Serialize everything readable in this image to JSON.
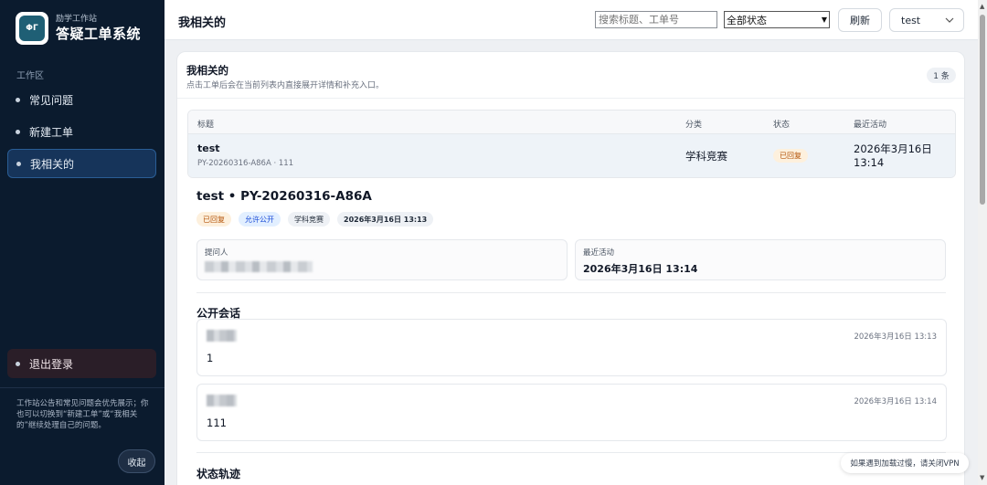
{
  "sidebar": {
    "logo_text": "ΦΓ",
    "brand_sub": "励学工作站",
    "brand_title": "答疑工单系统",
    "section_label": "工作区",
    "items": [
      {
        "label": "常见问题"
      },
      {
        "label": "新建工单"
      },
      {
        "label": "我相关的"
      }
    ],
    "logout_label": "退出登录",
    "note": "工作站公告和常见问题会优先展示；你也可以切换到“新建工单”或“我相关的”继续处理自己的问题。",
    "collapse_label": "收起"
  },
  "header": {
    "title": "我相关的",
    "search_placeholder": "搜索标题、工单号",
    "status_select": "全部状态",
    "refresh_label": "刷新",
    "user_label": "test"
  },
  "card": {
    "title": "我相关的",
    "subtitle": "点击工单后会在当前列表内直接展开详情和补充入口。",
    "count_badge": "1 条"
  },
  "table": {
    "headers": {
      "title": "标题",
      "category": "分类",
      "status": "状态",
      "activity": "最近活动"
    },
    "rows": [
      {
        "title": "test",
        "id_line": "PY-20260316-A86A · 111",
        "category": "学科竞赛",
        "status": "已回复",
        "activity": "2026年3月16日 13:14"
      }
    ]
  },
  "detail": {
    "title": "test • PY-20260316-A86A",
    "tags": {
      "status": "已回复",
      "visibility": "允许公开",
      "category": "学科竞赛",
      "created": "2026年3月16日 13:13"
    },
    "asker_label": "提问人",
    "activity_label": "最近活动",
    "activity_value": "2026年3月16日 13:14",
    "public_chat_heading": "公开会话",
    "messages": [
      {
        "time": "2026年3月16日 13:13",
        "body": "1"
      },
      {
        "time": "2026年3月16日 13:14",
        "body": "111"
      }
    ],
    "timeline_heading": "状态轨迹"
  },
  "toast": "如果遇到加载过慢，请关闭VPN",
  "colors": {
    "sidebar_bg": "#0b1b2e",
    "active_item_bg": "#16345a",
    "replied_badge": "#fdf0dd",
    "public_badge": "#e2efff"
  }
}
